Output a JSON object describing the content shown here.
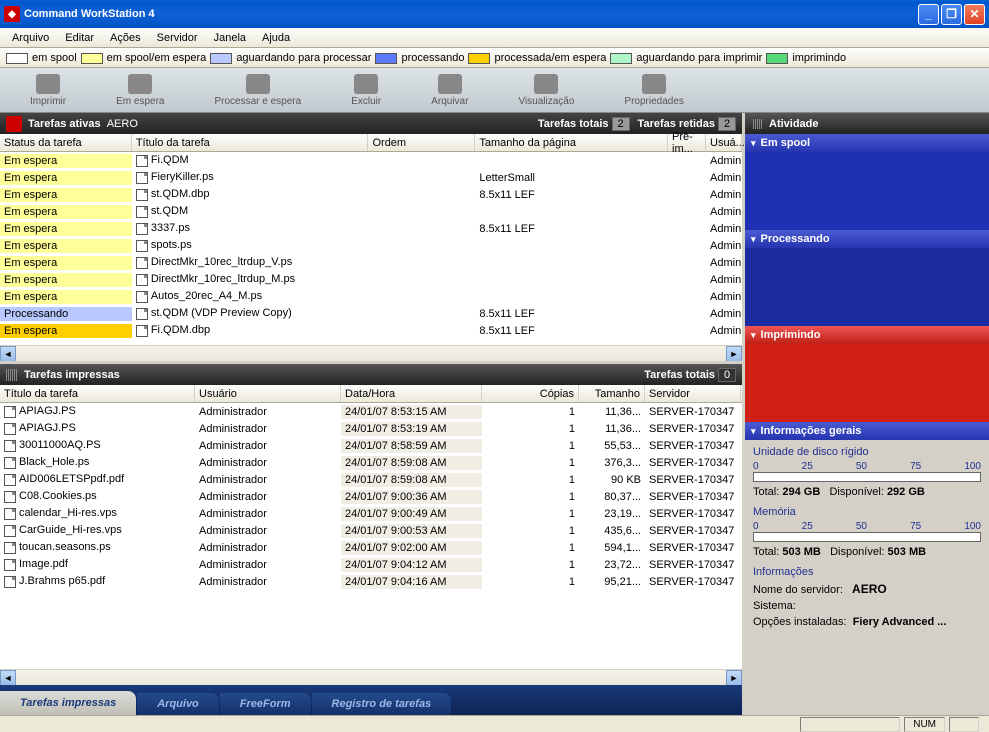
{
  "window": {
    "title": "Command WorkStation 4"
  },
  "menu": {
    "items": [
      "Arquivo",
      "Editar",
      "Ações",
      "Servidor",
      "Janela",
      "Ajuda"
    ]
  },
  "legend": [
    {
      "label": "em spool",
      "color": "#ffffff"
    },
    {
      "label": "em spool/em espera",
      "color": "#ffff99"
    },
    {
      "label": "aguardando para processar",
      "color": "#b9c8ff"
    },
    {
      "label": "processando",
      "color": "#5a7aff"
    },
    {
      "label": "processada/em espera",
      "color": "#ffcf00"
    },
    {
      "label": "aguardando para imprimir",
      "color": "#b0f5c8"
    },
    {
      "label": "imprimindo",
      "color": "#58d878"
    }
  ],
  "toolbar": [
    {
      "name": "print",
      "label": "Imprimir"
    },
    {
      "name": "hold",
      "label": "Em espera"
    },
    {
      "name": "process-hold",
      "label": "Processar e espera"
    },
    {
      "name": "delete",
      "label": "Excluir"
    },
    {
      "name": "archive",
      "label": "Arquivar"
    },
    {
      "name": "preview",
      "label": "Visualização"
    },
    {
      "name": "properties",
      "label": "Propriedades"
    }
  ],
  "active": {
    "title": "Tarefas ativas",
    "server": "AERO",
    "totals_label": "Tarefas totais",
    "totals_count": "2",
    "held_label": "Tarefas retidas",
    "held_count": "2",
    "columns": {
      "status": "Status da tarefa",
      "title": "Título da tarefa",
      "ordem": "Ordem",
      "tam": "Tamanho da página",
      "pre": "Pré-im...",
      "usu": "Usuá..."
    },
    "rows": [
      {
        "bg": "#ffff99",
        "status": "Em espera",
        "title": "Fi.QDM",
        "ordem": "",
        "tam": "",
        "usu": "Admin"
      },
      {
        "bg": "#ffff99",
        "status": "Em espera",
        "title": "FieryKiller.ps",
        "ordem": "",
        "tam": "LetterSmall",
        "usu": "Admin"
      },
      {
        "bg": "#ffff99",
        "status": "Em espera",
        "title": "st.QDM.dbp",
        "ordem": "",
        "tam": "8.5x11 LEF",
        "usu": "Admin"
      },
      {
        "bg": "#ffff99",
        "status": "Em espera",
        "title": "st.QDM",
        "ordem": "",
        "tam": "",
        "usu": "Admin"
      },
      {
        "bg": "#ffff99",
        "status": "Em espera",
        "title": "3337.ps",
        "ordem": "",
        "tam": "8.5x11 LEF",
        "usu": "Admin"
      },
      {
        "bg": "#ffff99",
        "status": "Em espera",
        "title": "spots.ps",
        "ordem": "",
        "tam": "",
        "usu": "Admin"
      },
      {
        "bg": "#ffff99",
        "status": "Em espera",
        "title": "DirectMkr_10rec_ltrdup_V.ps",
        "ordem": "",
        "tam": "",
        "usu": "Admin"
      },
      {
        "bg": "#ffff99",
        "status": "Em espera",
        "title": "DirectMkr_10rec_ltrdup_M.ps",
        "ordem": "",
        "tam": "",
        "usu": "Admin"
      },
      {
        "bg": "#ffff99",
        "status": "Em espera",
        "title": "Autos_20rec_A4_M.ps",
        "ordem": "",
        "tam": "",
        "usu": "Admin"
      },
      {
        "bg": "#b9c8ff",
        "status": "Processando",
        "title": "st.QDM (VDP Preview Copy)",
        "ordem": "",
        "tam": "8.5x11 LEF",
        "usu": "Admin"
      },
      {
        "bg": "#ffcf00",
        "status": "Em espera",
        "title": "Fi.QDM.dbp",
        "ordem": "",
        "tam": "8.5x11 LEF",
        "usu": "Admin"
      }
    ]
  },
  "printed": {
    "title": "Tarefas impressas",
    "totals_label": "Tarefas totais",
    "totals_count": "0",
    "columns": {
      "title": "Título da tarefa",
      "usu": "Usuário",
      "data": "Data/Hora",
      "cop": "Cópias",
      "tam": "Tamanho",
      "srv": "Servidor"
    },
    "rows": [
      {
        "title": "APIAGJ.PS",
        "usu": "Administrador",
        "data": "24/01/07  8:53:15 AM",
        "cop": "1",
        "tam": "11,36...",
        "srv": "SERVER-170347"
      },
      {
        "title": "APIAGJ.PS",
        "usu": "Administrador",
        "data": "24/01/07  8:53:19 AM",
        "cop": "1",
        "tam": "11,36...",
        "srv": "SERVER-170347"
      },
      {
        "title": "30011000AQ.PS",
        "usu": "Administrador",
        "data": "24/01/07  8:58:59 AM",
        "cop": "1",
        "tam": "55,53...",
        "srv": "SERVER-170347"
      },
      {
        "title": "Black_Hole.ps",
        "usu": "Administrador",
        "data": "24/01/07  8:59:08 AM",
        "cop": "1",
        "tam": "376,3...",
        "srv": "SERVER-170347"
      },
      {
        "title": "AID006LETSPpdf.pdf",
        "usu": "Administrador",
        "data": "24/01/07  8:59:08 AM",
        "cop": "1",
        "tam": "90 KB",
        "srv": "SERVER-170347"
      },
      {
        "title": "C08.Cookies.ps",
        "usu": "Administrador",
        "data": "24/01/07  9:00:36 AM",
        "cop": "1",
        "tam": "80,37...",
        "srv": "SERVER-170347"
      },
      {
        "title": "calendar_Hi-res.vps",
        "usu": "Administrador",
        "data": "24/01/07  9:00:49 AM",
        "cop": "1",
        "tam": "23,19...",
        "srv": "SERVER-170347"
      },
      {
        "title": "CarGuide_Hi-res.vps",
        "usu": "Administrador",
        "data": "24/01/07  9:00:53 AM",
        "cop": "1",
        "tam": "435,6...",
        "srv": "SERVER-170347"
      },
      {
        "title": "toucan.seasons.ps",
        "usu": "Administrador",
        "data": "24/01/07  9:02:00 AM",
        "cop": "1",
        "tam": "594,1...",
        "srv": "SERVER-170347"
      },
      {
        "title": "Image.pdf",
        "usu": "Administrador",
        "data": "24/01/07  9:04:12 AM",
        "cop": "1",
        "tam": "23,72...",
        "srv": "SERVER-170347"
      },
      {
        "title": "J.Brahms p65.pdf",
        "usu": "Administrador",
        "data": "24/01/07  9:04:16 AM",
        "cop": "1",
        "tam": "95,21...",
        "srv": "SERVER-170347"
      }
    ]
  },
  "tabs": [
    {
      "label": "Tarefas impressas",
      "active": true
    },
    {
      "label": "Arquivo",
      "active": false
    },
    {
      "label": "FreeForm",
      "active": false
    },
    {
      "label": "Registro de tarefas",
      "active": false
    }
  ],
  "activity": {
    "title": "Atividade",
    "spool": "Em spool",
    "processing": "Processando",
    "printing": "Imprimindo"
  },
  "general": {
    "title": "Informações gerais",
    "disk_label": "Unidade de disco rígido",
    "ticks": [
      "0",
      "25",
      "50",
      "75",
      "100"
    ],
    "disk_total_label": "Total:",
    "disk_total": "294 GB",
    "disk_avail_label": "Disponível:",
    "disk_avail": "292 GB",
    "mem_label": "Memória",
    "mem_total_label": "Total:",
    "mem_total": "503 MB",
    "mem_avail_label": "Disponível:",
    "mem_avail": "503 MB",
    "info_hdr": "Informações",
    "server_label": "Nome do servidor:",
    "server_name": "AERO",
    "system_label": "Sistema:",
    "opts_label": "Opções instaladas:",
    "opts_value": "Fiery Advanced ..."
  },
  "status": {
    "num": "NUM"
  }
}
